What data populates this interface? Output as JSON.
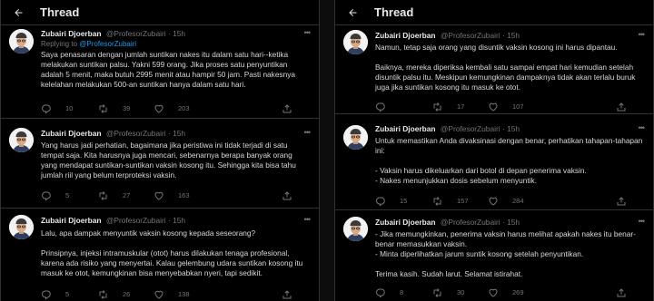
{
  "header": {
    "title": "Thread"
  },
  "author": {
    "name": "Zubairi Djoerban",
    "handle": "@ProfesorZubairi",
    "time": "15h",
    "dot": "·"
  },
  "left": {
    "t1": {
      "reply_prefix": "Replying to",
      "reply_mention": "@ProfesorZubairi",
      "paras": [
        "Saya penasaran dengan jumlah suntikan nakes itu dalam satu hari--ketika melakukan suntikan palsu. Yakni 599 orang. Jika proses satu penyuntikan adalah 5 menit, maka butuh 2995 menit atau hampir 50 jam. Pasti nakesnya kelelahan melakukan 500-an suntikan hanya dalam satu hari."
      ],
      "counts": {
        "reply": "10",
        "retweet": "39",
        "like": "203"
      }
    },
    "t2": {
      "paras": [
        "Yang harus jadi perhatian, bagaimana jika peristiwa ini tidak terjadi di satu tempat saja. Kita harusnya juga mencari, sebenarnya berapa banyak orang yang mendapat suntikan-suntikan vaksin kosong itu. Sehingga kita bisa tahu jumlah riil yang belum terproteksi vaksin."
      ],
      "counts": {
        "reply": "5",
        "retweet": "27",
        "like": "163"
      }
    },
    "t3": {
      "paras": [
        "Lalu, apa dampak menyuntik vaksin kosong kepada seseorang?",
        "Prinsipnya, injeksi intramuskular (otot) harus dilakukan tenaga profesional, karena ada risiko yang menyertai. Kalau gelembung udara suntikan kosong itu masuk ke otot, kemungkinan bisa menyebabkan nyeri, tapi sedikit."
      ],
      "counts": {
        "reply": "5",
        "retweet": "26",
        "like": "138"
      }
    }
  },
  "right": {
    "t1": {
      "paras": [
        "Namun, tetap saja orang yang disuntik vaksin kosong ini harus dipantau.",
        "Baiknya, mereka diperiksa kembali satu sampai empat hari kemudian setelah disuntik palsu itu. Meskipun kemungkinan dampaknya tidak akan terlalu buruk juga jika suntikan kosong itu masuk ke otot."
      ],
      "counts": {
        "reply": "",
        "retweet": "17",
        "like": "107"
      }
    },
    "t2": {
      "paras": [
        "Untuk memastikan Anda divaksinasi dengan benar, perhatikan tahapan-tahapan ini:",
        "- Vaksin harus dikeluarkan dari botol di depan penerima vaksin.\n- Nakes menunjukkan dosis sebelum menyuntik."
      ],
      "counts": {
        "reply": "15",
        "retweet": "157",
        "like": "284"
      }
    },
    "t3": {
      "paras": [
        "- Jika memungkinkan, penerima vaksin harus melihat apakah nakes itu benar-benar memasukkan vaksin.\n- Minta diperlihatkan jarum suntik kosong setelah penyuntikan.",
        "Terima kasih. Sudah larut. Selamat istirahat."
      ],
      "counts": {
        "reply": "8",
        "retweet": "30",
        "like": "269"
      }
    }
  },
  "icons": {
    "back": "arrow-left-icon",
    "more": "more-icon",
    "reply": "reply-icon",
    "retweet": "retweet-icon",
    "like": "heart-icon",
    "share": "share-icon"
  },
  "colors": {
    "background": "#000000",
    "link": "#1d9bf0",
    "muted": "#71767b",
    "text": "#d9d9d9"
  }
}
